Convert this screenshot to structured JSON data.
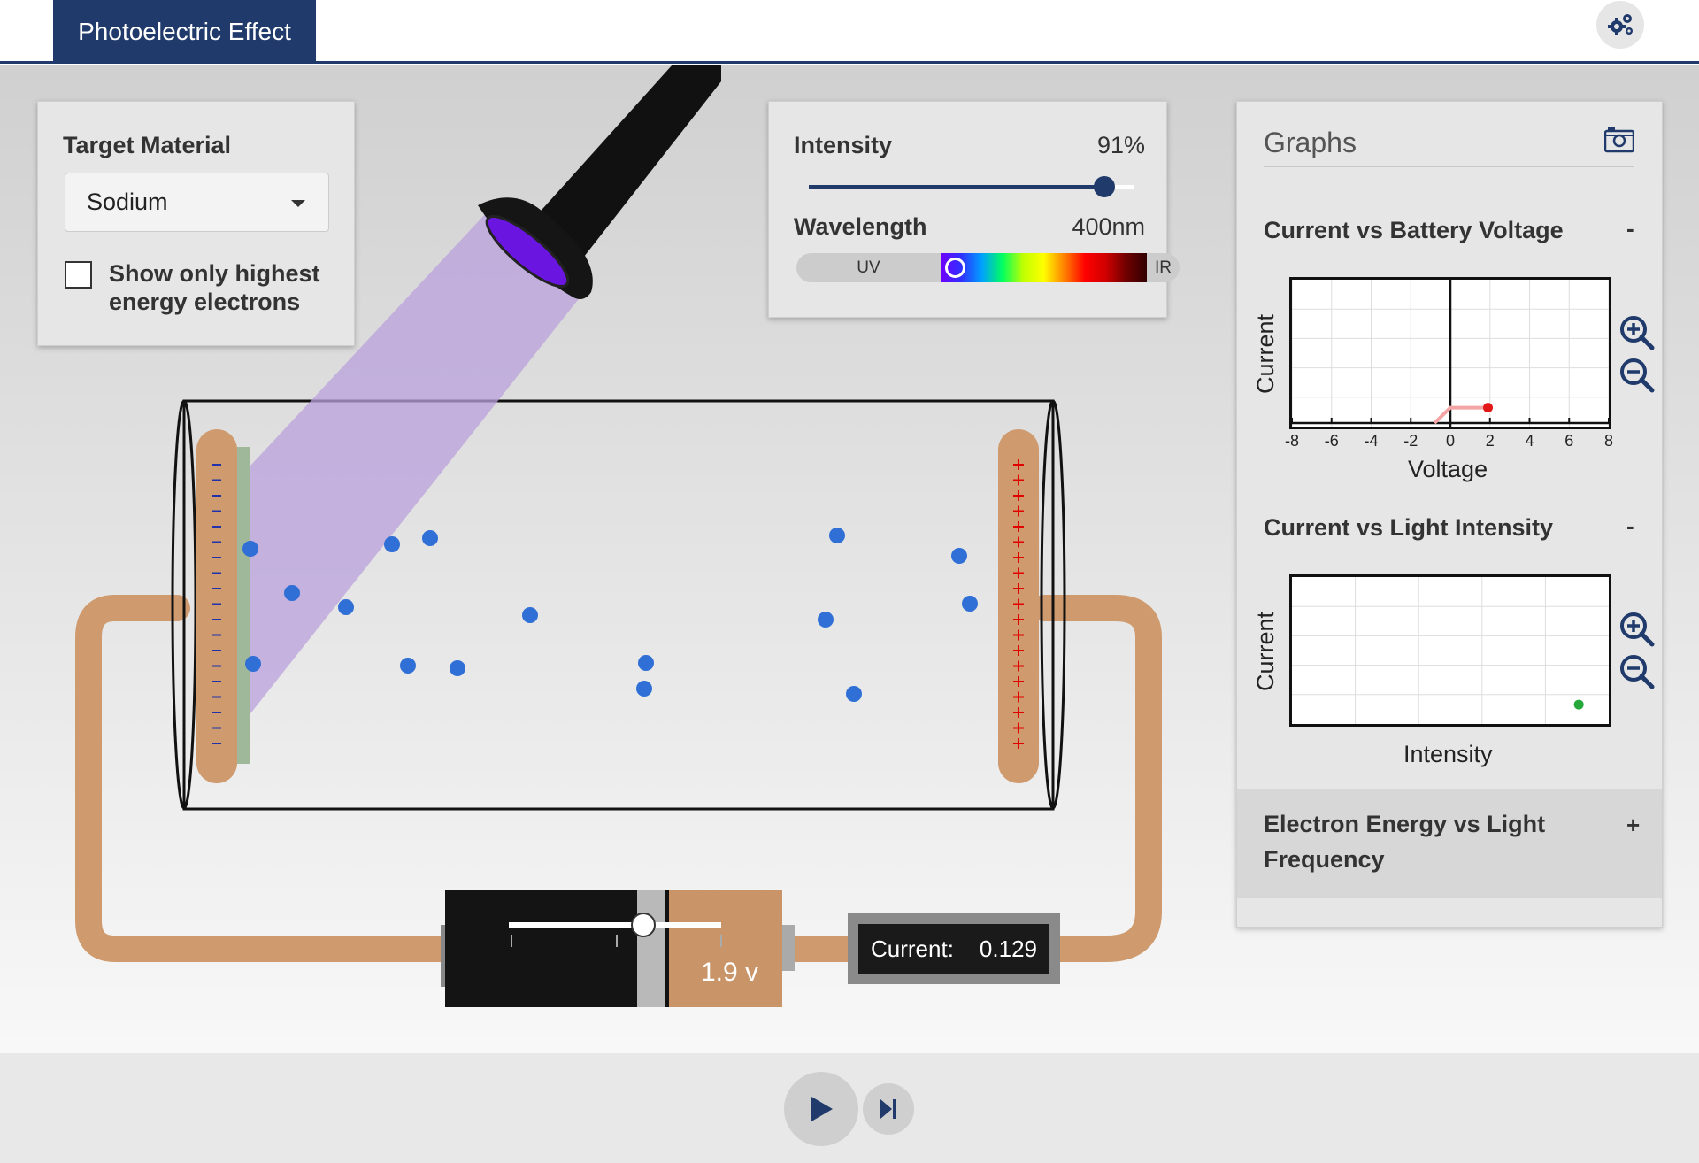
{
  "header": {
    "app_title": "Photoelectric Effect",
    "settings_icon": "gears-icon"
  },
  "target": {
    "title": "Target Material",
    "material": "Sodium",
    "highest_energy_label": "Show only highest energy electrons",
    "highest_energy_checked": false
  },
  "light": {
    "intensity_label": "Intensity",
    "intensity_value": "91%",
    "intensity_fraction": 0.91,
    "wavelength_label": "Wavelength",
    "wavelength_value": "400nm",
    "uv_label": "UV",
    "ir_label": "IR"
  },
  "battery": {
    "voltage_label": "1.9 v"
  },
  "meter": {
    "label": "Current:",
    "value": "0.129"
  },
  "graphs": {
    "title": "Graphs",
    "camera_icon": "camera-icon",
    "voltage_graph": {
      "title": "Current vs Battery Voltage",
      "toggle": "-",
      "ylabel": "Current",
      "xlabel": "Voltage",
      "ticks": [
        "-8",
        "-6",
        "-4",
        "-2",
        "0",
        "2",
        "4",
        "6",
        "8"
      ]
    },
    "intensity_graph": {
      "title": "Current vs Light Intensity",
      "toggle": "-",
      "ylabel": "Current",
      "xlabel": "Intensity"
    },
    "energy_graph": {
      "title": "Electron Energy vs Light Frequency",
      "toggle": "+"
    }
  },
  "colors": {
    "brand": "#1f3a6b",
    "wire": "#cf9b6e",
    "electron": "#2f6fd6",
    "beam": "#b9a0dc",
    "voltage_point": "#e21818",
    "intensity_point": "#27a83a"
  },
  "chart_data": [
    {
      "type": "line",
      "title": "Current vs Battery Voltage",
      "xlabel": "Voltage",
      "ylabel": "Current",
      "xlim": [
        -8,
        8
      ],
      "x_ticks": [
        -8,
        -6,
        -4,
        -2,
        0,
        2,
        4,
        6,
        8
      ],
      "grid": true,
      "series": [
        {
          "x": [
            -0.8,
            0,
            2
          ],
          "y": [
            0,
            0.129,
            0.129
          ]
        }
      ],
      "current_point": {
        "x": 1.9,
        "y": 0.129
      }
    },
    {
      "type": "scatter",
      "title": "Current vs Light Intensity",
      "xlabel": "Intensity",
      "ylabel": "Current",
      "grid": true,
      "series": [
        {
          "x": [
            91
          ],
          "y": [
            0.129
          ]
        }
      ]
    }
  ]
}
